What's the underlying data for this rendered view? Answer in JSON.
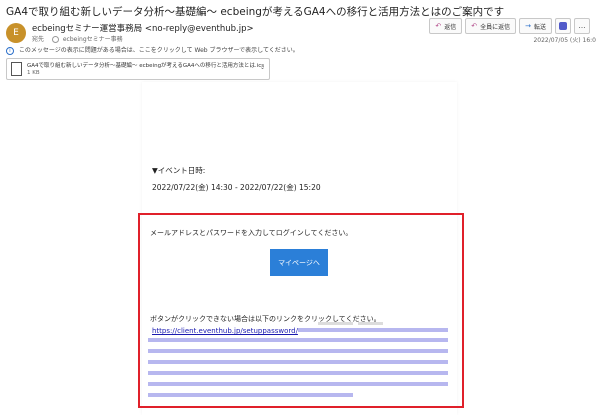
{
  "email": {
    "subject": "GA4で取り組む新しいデータ分析～基礎編～ ecbeingが考えるGA4への移行と活用方法とはのご案内です",
    "avatar_initial": "E",
    "sender": "ecbeingセミナー運営事務局 <no-reply@eventhub.jp>",
    "to_label": "宛先",
    "to_value": "ecbeingセミナー事務",
    "date": "2022/07/05 (火) 16:0",
    "info_bar": "このメッセージの表示に問題がある場合は、ここをクリックして Web ブラウザーで表示してください。",
    "attachment": {
      "name": "GA4で取り組む新しいデータ分析～基礎編～ ecbeingが考えるGA4への移行と活用方法とは.ics",
      "size": "1 KB"
    }
  },
  "actions": {
    "reply": "返信",
    "reply_all": "全員に返信",
    "forward": "転送",
    "more": "…"
  },
  "body": {
    "event_label": "▼イベント日時:",
    "event_date": "2022/07/22(金) 14:30 - 2022/07/22(金) 15:20",
    "login_message": "メールアドレスとパスワードを入力してログインしてください。",
    "mypage_button": "マイページへ",
    "fallback_message": "ボタンがクリックできない場合は以下のリンクをクリックしてください。",
    "fallback_link": "https://client.eventhub.jp/setuppassword/"
  },
  "colors": {
    "highlight_border": "#e0202a",
    "button_bg": "#2b7fd8",
    "link": "#1a1ab0",
    "avatar": "#c8912a"
  }
}
